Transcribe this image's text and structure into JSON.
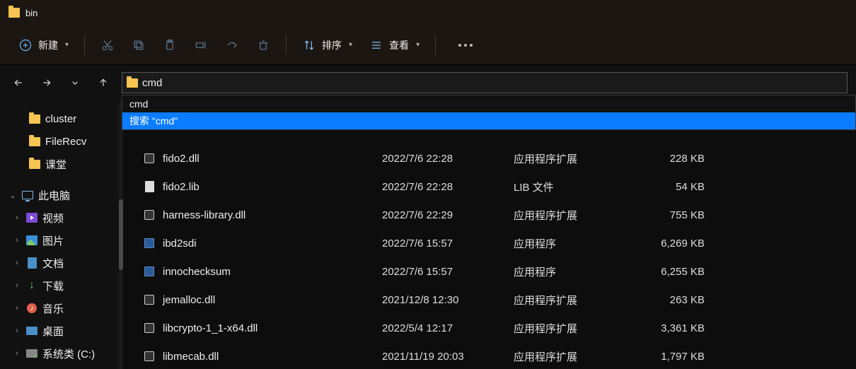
{
  "window": {
    "title": "bin"
  },
  "toolbar": {
    "new_label": "新建",
    "sort_label": "排序",
    "view_label": "查看"
  },
  "address": {
    "value": "cmd"
  },
  "suggestions": {
    "items": [
      {
        "text": "cmd",
        "selected": false
      },
      {
        "text": "搜索 \"cmd\"",
        "selected": true
      }
    ]
  },
  "sidebar": {
    "quick": [
      {
        "label": "cluster"
      },
      {
        "label": "FileRecv"
      },
      {
        "label": "课堂"
      }
    ],
    "thispc_label": "此电脑",
    "folders": [
      {
        "label": "视频",
        "icon": "video"
      },
      {
        "label": "图片",
        "icon": "image"
      },
      {
        "label": "文档",
        "icon": "doc"
      },
      {
        "label": "下载",
        "icon": "download"
      },
      {
        "label": "音乐",
        "icon": "music"
      },
      {
        "label": "桌面",
        "icon": "desktop"
      },
      {
        "label": "系统类 (C:)",
        "icon": "drive"
      }
    ]
  },
  "files": [
    {
      "name": "fido2.dll",
      "date": "2022/7/6 22:28",
      "type": "应用程序扩展",
      "size": "228 KB",
      "icon": "dll"
    },
    {
      "name": "fido2.lib",
      "date": "2022/7/6 22:28",
      "type": "LIB 文件",
      "size": "54 KB",
      "icon": "lib"
    },
    {
      "name": "harness-library.dll",
      "date": "2022/7/6 22:29",
      "type": "应用程序扩展",
      "size": "755 KB",
      "icon": "dll"
    },
    {
      "name": "ibd2sdi",
      "date": "2022/7/6 15:57",
      "type": "应用程序",
      "size": "6,269 KB",
      "icon": "exe"
    },
    {
      "name": "innochecksum",
      "date": "2022/7/6 15:57",
      "type": "应用程序",
      "size": "6,255 KB",
      "icon": "exe"
    },
    {
      "name": "jemalloc.dll",
      "date": "2021/12/8 12:30",
      "type": "应用程序扩展",
      "size": "263 KB",
      "icon": "dll"
    },
    {
      "name": "libcrypto-1_1-x64.dll",
      "date": "2022/5/4 12:17",
      "type": "应用程序扩展",
      "size": "3,361 KB",
      "icon": "dll"
    },
    {
      "name": "libmecab.dll",
      "date": "2021/11/19 20:03",
      "type": "应用程序扩展",
      "size": "1,797 KB",
      "icon": "dll"
    }
  ]
}
